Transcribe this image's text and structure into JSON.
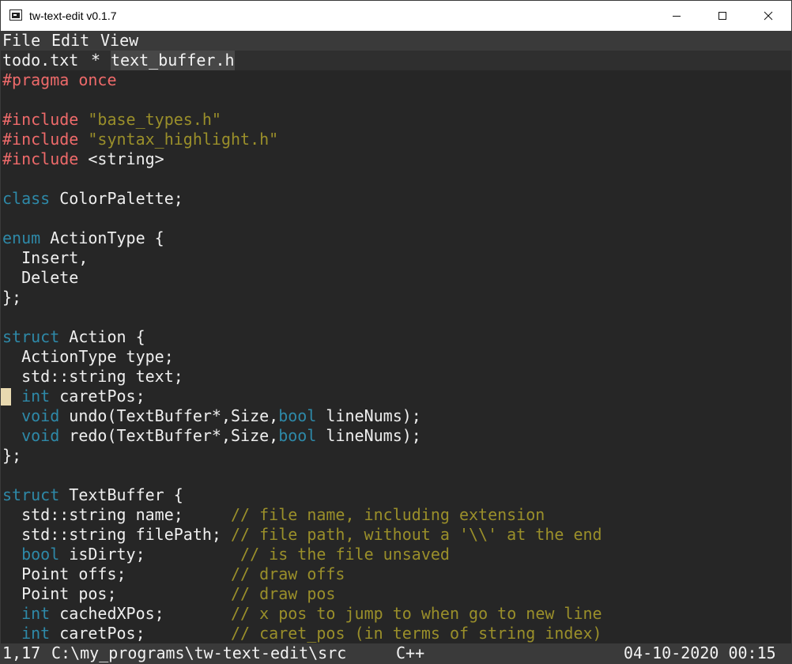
{
  "window": {
    "title": "tw-text-edit v0.1.7"
  },
  "menu": {
    "file": "File",
    "edit": "Edit",
    "view": "View"
  },
  "tabs": {
    "first": "todo.txt",
    "separator": "*",
    "active": "text_buffer.h"
  },
  "code": {
    "l1": {
      "a": "#pragma once"
    },
    "l3": {
      "a": "#include",
      "b": "\"base_types.h\""
    },
    "l4": {
      "a": "#include",
      "b": "\"syntax_highlight.h\""
    },
    "l5": {
      "a": "#include",
      "b": "<string>"
    },
    "l7": {
      "a": "class",
      "b": " ColorPalette;"
    },
    "l9": {
      "a": "enum",
      "b": " ActionType {"
    },
    "l10": {
      "a": "  Insert,"
    },
    "l11": {
      "a": "  Delete"
    },
    "l12": {
      "a": "};"
    },
    "l14": {
      "a": "struct",
      "b": " Action {"
    },
    "l15": {
      "a": "  ActionType type;"
    },
    "l16": {
      "a": "  std::string text;"
    },
    "l17": {
      "a": "int",
      "b": " caretPos;"
    },
    "l18": {
      "a": "void",
      "b": " undo(TextBuffer*,Size,",
      "c": "bool",
      "d": " lineNums);"
    },
    "l19": {
      "a": "void",
      "b": " redo(TextBuffer*,Size,",
      "c": "bool",
      "d": " lineNums);"
    },
    "l20": {
      "a": "};"
    },
    "l22": {
      "a": "struct",
      "b": " TextBuffer {"
    },
    "l23": {
      "a": "  std::string name;     ",
      "b": "// file name, including extension"
    },
    "l24": {
      "a": "  std::string filePath; ",
      "b": "// file path, without a '\\\\' at the end"
    },
    "l25": {
      "a": "bool",
      "b": " isDirty;          ",
      "c": "// is the file unsaved"
    },
    "l26": {
      "a": "  Point offs;           ",
      "b": "// draw offs"
    },
    "l27": {
      "a": "  Point pos;            ",
      "b": "// draw pos"
    },
    "l28": {
      "a": "int",
      "b": " cachedXPos;       ",
      "c": "// x pos to jump to when go to new line"
    },
    "l29": {
      "a": "int",
      "b": " caretPos;         ",
      "c": "// caret_pos (in terms of string index)"
    }
  },
  "status": {
    "position": "1,17",
    "path": "C:\\my_programs\\tw-text-edit\\src",
    "language": "C++",
    "datetime": "04-10-2020 00:15"
  },
  "colors": {
    "background": "#262626",
    "preprocessor": "#ee6a6a",
    "string": "#9a8f2a",
    "keyword": "#2e89a8",
    "comment": "#9a8f2a",
    "caret": "#e8d9b0"
  }
}
